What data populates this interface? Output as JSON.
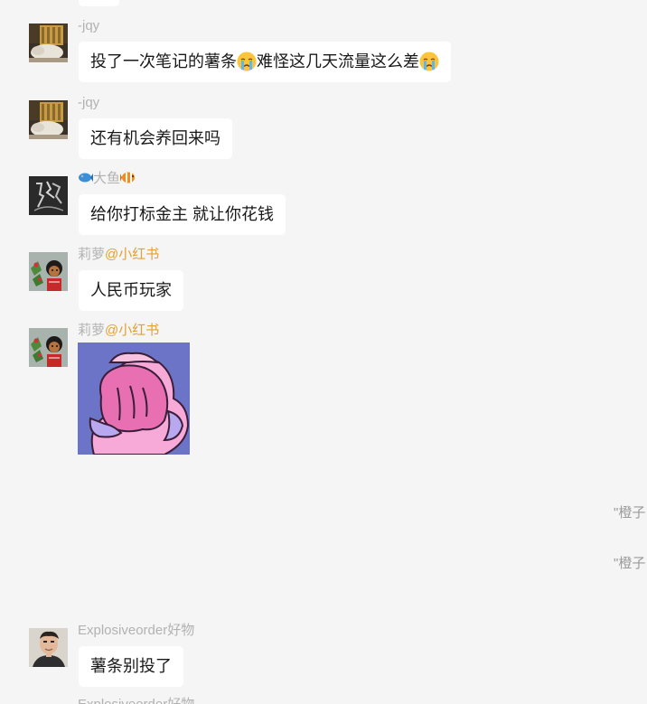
{
  "chat": {
    "messages": [
      {
        "sender": "-jqy",
        "text_parts": [
          "投了一次笔记的薯条",
          "难怪这几天流量这么差"
        ],
        "emojis": [
          "crying-face-icon",
          "crying-face-icon"
        ]
      },
      {
        "sender": "-jqy",
        "text": "还有机会养回来吗"
      },
      {
        "sender": "大鱼",
        "sender_icons": [
          "blue-fish-icon",
          "tropical-fish-icon"
        ],
        "text": "给你打标金主 就让你花钱"
      },
      {
        "sender": "莉萝",
        "sender_tag": "@小红书",
        "text": "人民币玩家"
      },
      {
        "sender": "莉萝",
        "sender_tag": "@小红书",
        "sticker": "pink-pig-hiding-face-sticker"
      },
      {
        "sender": "Explosiveorder好物",
        "text": "薯条别投了"
      },
      {
        "sender": "Explosiveorder好物"
      }
    ],
    "system_notes": [
      "\"橙子",
      "\"橙子"
    ]
  },
  "colors": {
    "background": "#f5f5f5",
    "bubble": "#ffffff",
    "sender_name": "#b2b2b2",
    "sender_tag": "#e3a132",
    "text": "#191919"
  }
}
